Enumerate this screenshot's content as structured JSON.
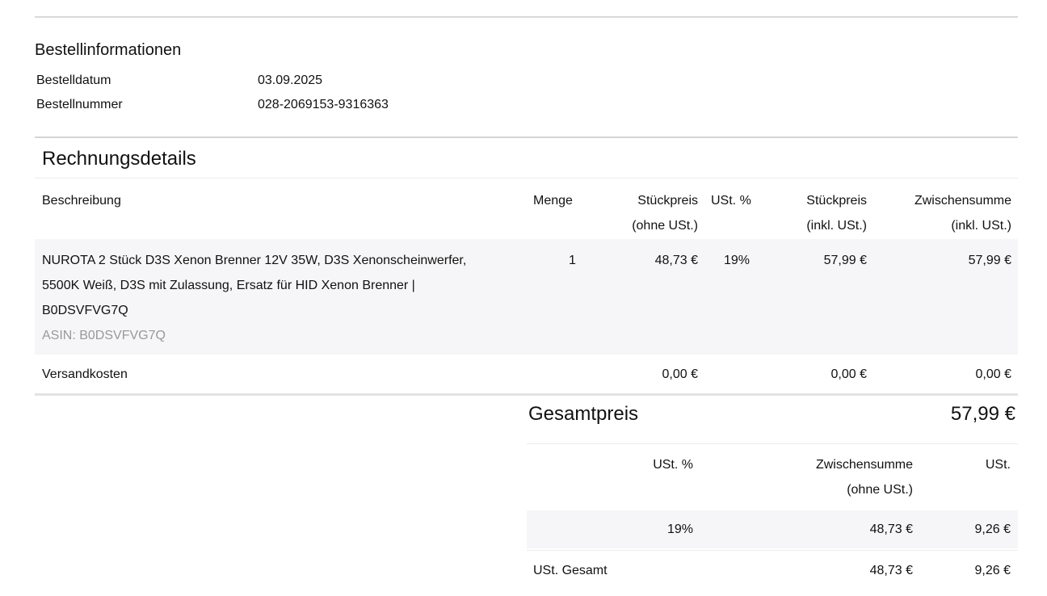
{
  "order_info": {
    "title": "Bestellinformationen",
    "rows": [
      {
        "label": "Bestelldatum",
        "value": "03.09.2025"
      },
      {
        "label": "Bestellnummer",
        "value": "028-2069153-9316363"
      }
    ]
  },
  "invoice": {
    "title": "Rechnungsdetails",
    "headers": {
      "description": "Beschreibung",
      "quantity": "Menge",
      "unit_price_net": [
        "Stückpreis",
        "(ohne USt.)"
      ],
      "vat_pct": "USt. %",
      "unit_price_gross": [
        "Stückpreis",
        "(inkl. USt.)"
      ],
      "subtotal_gross": [
        "Zwischensumme",
        "(inkl. USt.)"
      ]
    },
    "item": {
      "description_lines": [
        "NUROTA 2 Stück D3S Xenon Brenner 12V 35W, D3S Xenonscheinwerfer,",
        "5500K Weiß, D3S mit Zulassung, Ersatz für HID Xenon Brenner |",
        "B0DSVFVG7Q"
      ],
      "asin": "ASIN: B0DSVFVG7Q",
      "quantity": "1",
      "unit_price_net": "48,73 €",
      "vat_pct": "19%",
      "unit_price_gross": "57,99 €",
      "subtotal_gross": "57,99 €"
    },
    "shipping": {
      "label": "Versandkosten",
      "unit_price_net": "0,00 €",
      "unit_price_gross": "0,00 €",
      "subtotal_gross": "0,00 €"
    },
    "total": {
      "label": "Gesamtpreis",
      "value": "57,99 €"
    }
  },
  "vat_summary": {
    "headers": {
      "vat_pct": "USt. %",
      "subtotal_net": [
        "Zwischensumme",
        "(ohne USt.)"
      ],
      "vat": "USt."
    },
    "row": {
      "vat_pct": "19%",
      "subtotal_net": "48,73 €",
      "vat": "9,26 €"
    },
    "total": {
      "label": "USt. Gesamt",
      "subtotal_net": "48,73 €",
      "vat": "9,26 €"
    }
  },
  "colors": {
    "row_band": "#f6f6f8",
    "rule": "#d5d5d5",
    "muted_text": "#999999"
  }
}
